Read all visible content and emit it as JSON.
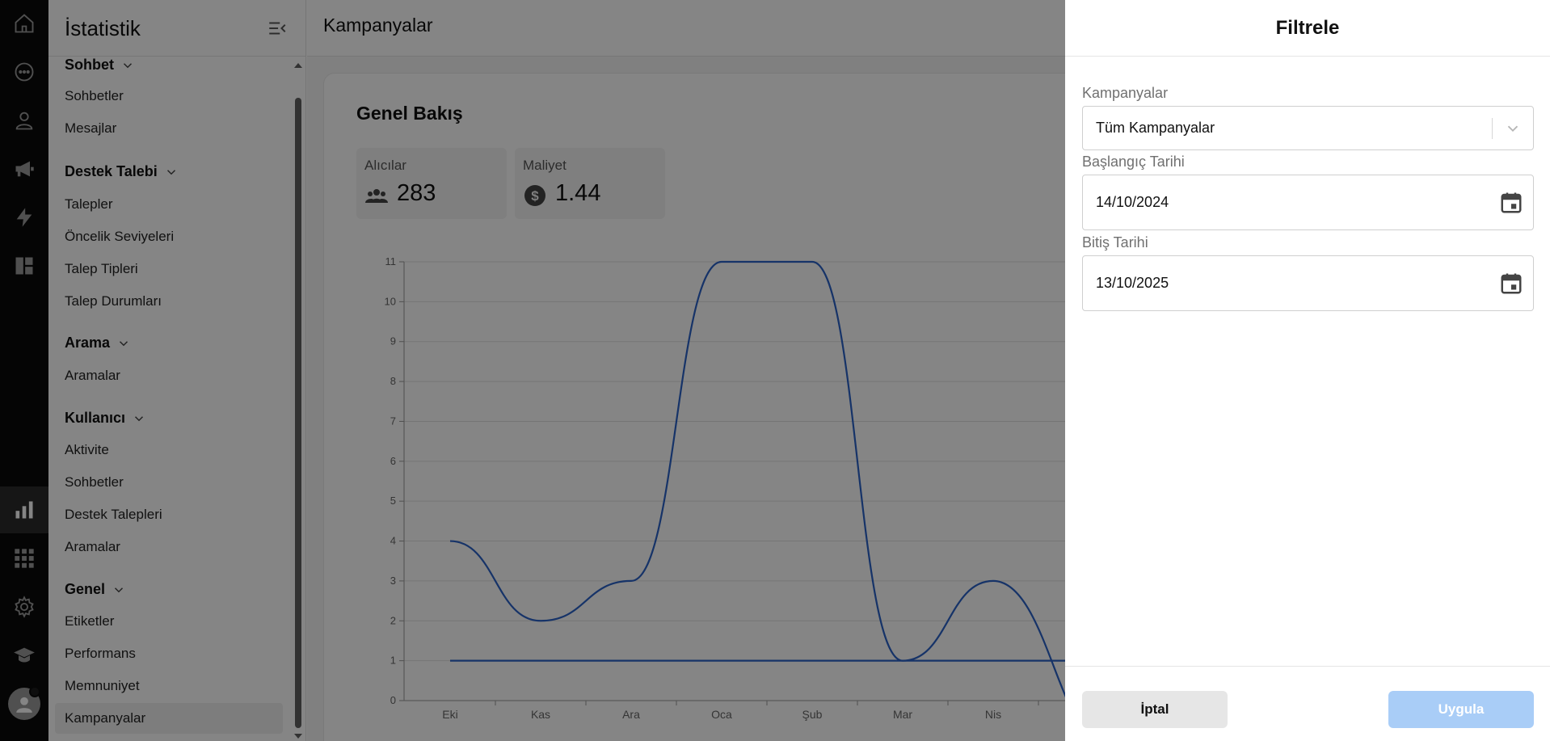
{
  "sidebar": {
    "title": "İstatistik",
    "sections": [
      {
        "label": "Sohbet",
        "items": [
          "Sohbetler",
          "Mesajlar"
        ]
      },
      {
        "label": "Destek Talebi",
        "items": [
          "Talepler",
          "Öncelik Seviyeleri",
          "Talep Tipleri",
          "Talep Durumları"
        ]
      },
      {
        "label": "Arama",
        "items": [
          "Aramalar"
        ]
      },
      {
        "label": "Kullanıcı",
        "items": [
          "Aktivite",
          "Sohbetler",
          "Destek Talepleri",
          "Aramalar"
        ]
      },
      {
        "label": "Genel",
        "items": [
          "Etiketler",
          "Performans",
          "Memnuniyet",
          "Kampanyalar"
        ]
      }
    ],
    "selected_item": "Kampanyalar"
  },
  "rail": {
    "icons": [
      "home-icon",
      "chat-icon",
      "user-icon",
      "megaphone-icon",
      "lightning-icon",
      "dashboard-icon",
      "bar-chart-icon",
      "apps-grid-icon",
      "settings-gear-icon",
      "graduation-cap-icon"
    ],
    "active_icon": "bar-chart-icon"
  },
  "main": {
    "page_title": "Kampanyalar",
    "overview_title": "Genel Bakış",
    "stats": [
      {
        "label": "Alıcılar",
        "value": "283",
        "icon": "group-icon"
      },
      {
        "label": "Maliyet",
        "value": "1.44",
        "icon": "dollar-icon"
      }
    ]
  },
  "chart_data": {
    "type": "line",
    "categories": [
      "Eki",
      "Kas",
      "Ara",
      "Oca",
      "Şub",
      "Mar",
      "Nis"
    ],
    "series": [
      {
        "values": [
          4,
          2,
          3,
          11,
          11,
          1,
          3
        ],
        "color": "#2b62c8"
      },
      {
        "values": [
          1,
          1,
          1,
          1,
          1,
          1,
          1
        ],
        "color": "#2b62c8"
      }
    ],
    "ylim": [
      0,
      11
    ],
    "yticks": [
      0,
      1,
      2,
      3,
      4,
      5,
      6,
      7,
      8,
      9,
      10,
      11
    ],
    "grid": true
  },
  "filter": {
    "title": "Filtrele",
    "campaigns_label": "Kampanyalar",
    "campaigns_value": "Tüm Kampanyalar",
    "start_label": "Başlangıç Tarihi",
    "start_value": "14/10/2024",
    "end_label": "Bitiş Tarihi",
    "end_value": "13/10/2025",
    "cancel_label": "İptal",
    "apply_label": "Uygula"
  },
  "colors": {
    "accent": "#2b62c8",
    "apply_button": "#a9cdf7",
    "rail": "#0b0b0b"
  }
}
